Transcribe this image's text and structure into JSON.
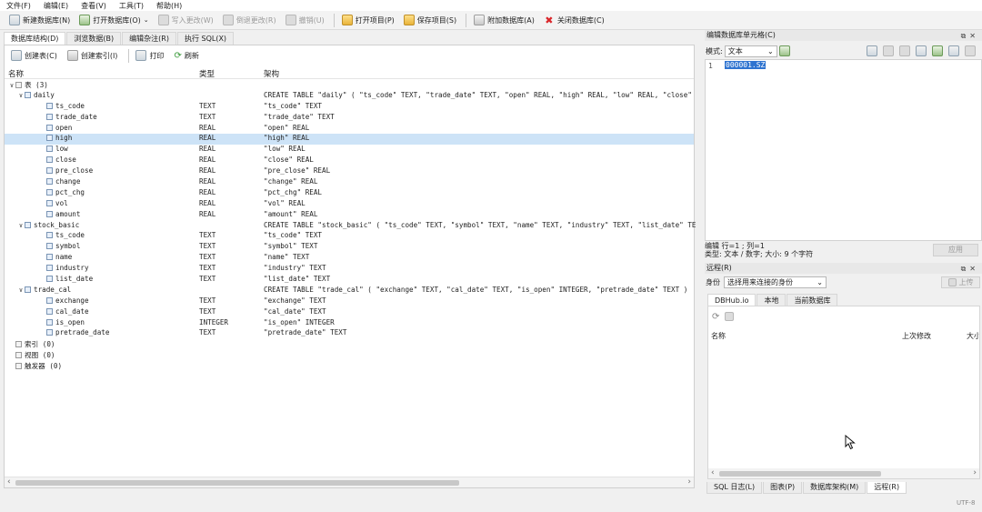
{
  "menu": [
    "文件(F)",
    "编辑(E)",
    "查看(V)",
    "工具(T)",
    "帮助(H)"
  ],
  "toolbar": {
    "new_db": "新建数据库(N)",
    "open_db": "打开数据库(O)",
    "write_changes": "写入更改(W)",
    "revert_changes": "倒退更改(R)",
    "undo": "撤销(U)",
    "open_project": "打开项目(P)",
    "save_project": "保存项目(S)",
    "attach_db": "附加数据库(A)",
    "close_db": "关闭数据库(C)"
  },
  "main_tabs": [
    "数据库结构(D)",
    "浏览数据(B)",
    "编辑杂注(R)",
    "执行 SQL(X)"
  ],
  "structure_toolbar": {
    "create_table": "创建表(C)",
    "create_index": "创建索引(I)",
    "print": "打印",
    "refresh": "刷新"
  },
  "columns": {
    "name": "名称",
    "type": "类型",
    "schema": "架构"
  },
  "tree": [
    {
      "level": 0,
      "chevron": "∨",
      "name": "表 (3)",
      "type": "",
      "schema": "",
      "icon": "group"
    },
    {
      "level": 1,
      "chevron": "∨",
      "name": "daily",
      "type": "",
      "schema": "CREATE TABLE \"daily\" ( \"ts_code\" TEXT, \"trade_date\" TEXT, \"open\" REAL, \"high\" REAL, \"low\" REAL, \"close\"",
      "icon": "table"
    },
    {
      "level": 2,
      "name": "ts_code",
      "type": "TEXT",
      "schema": "\"ts_code\" TEXT",
      "icon": "field"
    },
    {
      "level": 2,
      "name": "trade_date",
      "type": "TEXT",
      "schema": "\"trade_date\" TEXT",
      "icon": "field"
    },
    {
      "level": 2,
      "name": "open",
      "type": "REAL",
      "schema": "\"open\" REAL",
      "icon": "field"
    },
    {
      "level": 2,
      "name": "high",
      "type": "REAL",
      "schema": "\"high\" REAL",
      "icon": "field",
      "selected": true
    },
    {
      "level": 2,
      "name": "low",
      "type": "REAL",
      "schema": "\"low\" REAL",
      "icon": "field"
    },
    {
      "level": 2,
      "name": "close",
      "type": "REAL",
      "schema": "\"close\" REAL",
      "icon": "field"
    },
    {
      "level": 2,
      "name": "pre_close",
      "type": "REAL",
      "schema": "\"pre_close\" REAL",
      "icon": "field"
    },
    {
      "level": 2,
      "name": "change",
      "type": "REAL",
      "schema": "\"change\" REAL",
      "icon": "field"
    },
    {
      "level": 2,
      "name": "pct_chg",
      "type": "REAL",
      "schema": "\"pct_chg\" REAL",
      "icon": "field"
    },
    {
      "level": 2,
      "name": "vol",
      "type": "REAL",
      "schema": "\"vol\" REAL",
      "icon": "field"
    },
    {
      "level": 2,
      "name": "amount",
      "type": "REAL",
      "schema": "\"amount\" REAL",
      "icon": "field"
    },
    {
      "level": 1,
      "chevron": "∨",
      "name": "stock_basic",
      "type": "",
      "schema": "CREATE TABLE \"stock_basic\" ( \"ts_code\" TEXT, \"symbol\" TEXT, \"name\" TEXT, \"industry\" TEXT, \"list_date\" TE",
      "icon": "table"
    },
    {
      "level": 2,
      "name": "ts_code",
      "type": "TEXT",
      "schema": "\"ts_code\" TEXT",
      "icon": "field"
    },
    {
      "level": 2,
      "name": "symbol",
      "type": "TEXT",
      "schema": "\"symbol\" TEXT",
      "icon": "field"
    },
    {
      "level": 2,
      "name": "name",
      "type": "TEXT",
      "schema": "\"name\" TEXT",
      "icon": "field"
    },
    {
      "level": 2,
      "name": "industry",
      "type": "TEXT",
      "schema": "\"industry\" TEXT",
      "icon": "field"
    },
    {
      "level": 2,
      "name": "list_date",
      "type": "TEXT",
      "schema": "\"list_date\" TEXT",
      "icon": "field"
    },
    {
      "level": 1,
      "chevron": "∨",
      "name": "trade_cal",
      "type": "",
      "schema": "CREATE TABLE \"trade_cal\" ( \"exchange\" TEXT, \"cal_date\" TEXT, \"is_open\" INTEGER, \"pretrade_date\" TEXT )",
      "icon": "table"
    },
    {
      "level": 2,
      "name": "exchange",
      "type": "TEXT",
      "schema": "\"exchange\" TEXT",
      "icon": "field"
    },
    {
      "level": 2,
      "name": "cal_date",
      "type": "TEXT",
      "schema": "\"cal_date\" TEXT",
      "icon": "field"
    },
    {
      "level": 2,
      "name": "is_open",
      "type": "INTEGER",
      "schema": "\"is_open\" INTEGER",
      "icon": "field"
    },
    {
      "level": 2,
      "name": "pretrade_date",
      "type": "TEXT",
      "schema": "\"pretrade_date\" TEXT",
      "icon": "field"
    },
    {
      "level": 0,
      "chevron": "",
      "name": "索引 (0)",
      "type": "",
      "schema": "",
      "icon": "index"
    },
    {
      "level": 0,
      "chevron": "",
      "name": "视图 (0)",
      "type": "",
      "schema": "",
      "icon": "view"
    },
    {
      "level": 0,
      "chevron": "",
      "name": "触发器 (0)",
      "type": "",
      "schema": "",
      "icon": "trigger"
    }
  ],
  "cell_editor": {
    "title": "编辑数据库单元格(C)",
    "mode_label": "模式:",
    "mode_value": "文本",
    "line_number": "1",
    "value": "000001.SZ",
    "status_line1": "编辑 行=1 ; 列=1",
    "status_line2": "类型: 文本 / 数字; 大小: 9 个字符",
    "apply": "应用"
  },
  "remote": {
    "title": "远程(R)",
    "identity_label": "身份",
    "identity_value": "选择用来连接的身份",
    "upload": "上传",
    "tabs": [
      "DBHub.io",
      "本地",
      "当前数据库"
    ],
    "col_name": "名称",
    "col_modified": "上次修改",
    "col_size": "大小"
  },
  "bottom_tabs": [
    "SQL 日志(L)",
    "图表(P)",
    "数据库架构(M)",
    "远程(R)"
  ],
  "encoding": "UTF-8",
  "colors": {
    "selection": "#cde3f7",
    "highlight": "#2f74d0"
  }
}
